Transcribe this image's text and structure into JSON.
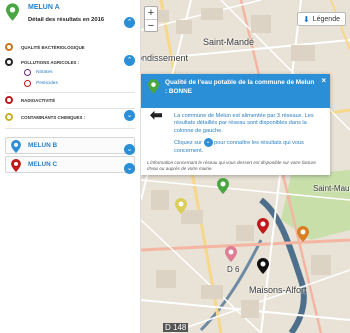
{
  "sidebar": {
    "commune_a": {
      "title": "MELUN A",
      "subtitle": "Détail des résultats en 2016"
    },
    "items": [
      {
        "label": "QUALITÉ BACTÉRIOLOGIQUE",
        "color": "#c77420"
      },
      {
        "label": "POLLUTIONS AGRICOLES :",
        "color": "#222222"
      },
      {
        "label": "RADIOACTIVITÉ",
        "color": "#c01a1a"
      },
      {
        "label": "CONTAMINANTS CHIMIQUES :",
        "color": "#c9b02a"
      }
    ],
    "agricultural_sub": [
      {
        "label": "Nitrates"
      },
      {
        "label": "Pesticides"
      }
    ],
    "commune_b": {
      "title": "MELUN B",
      "color": "#2a8fd6"
    },
    "commune_c": {
      "title": "MELUN C",
      "color": "#c01a1a"
    }
  },
  "map": {
    "labels": {
      "saint_mande": "Saint-Mandé",
      "arrondissement": "ondissement",
      "saint_maurice": "Saint-Maur",
      "d6": "D 6",
      "maisons_alfort": "Maisons-Alfort",
      "d148": "D 148"
    },
    "zoom_in": "+",
    "zoom_out": "−",
    "legend_label": "Légende"
  },
  "popup": {
    "title": "Qualité de l'eau potable de la commune de Melun : BONNE",
    "body_1": "La commune de Melun est alimentée par 3 réseaux. Les résultats détaillés par réseau sont disponibles dans la colonne de gauche.",
    "body_2_pre": "Cliquez sur",
    "body_2_post": "pour connaître les résultats qui vous concernent.",
    "footnote": "L'information concernant le réseau qui vous dessert est disponible sur votre facture d'eau ou auprès de votre mairie.",
    "close": "×",
    "accent": "#2a8fd6"
  }
}
